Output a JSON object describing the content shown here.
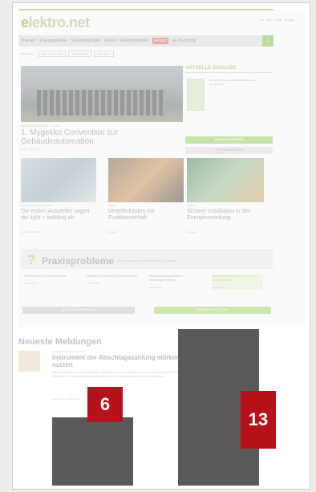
{
  "site": {
    "logo": "elektro.net",
    "logo_letter": "e",
    "top_links": "Abo · Jobs · Kontakt · Newsletter",
    "nav": [
      "Themen",
      "Praxisprobleme",
      "Veranstaltungen",
      "Preise",
      "Elektrohelpdesk"
    ],
    "nav_highlight": "ePaper",
    "nav_shop": "de-Buchshop",
    "search_icon": "search-icon",
    "subnav_label": "Topthemen:",
    "subnav": [
      "light + building 2024",
      "Elektromobilität",
      "Smart Home"
    ]
  },
  "hero": {
    "meta": "GEBÄUDEAUTOMATION · PRAXIS",
    "title": "1. Mygekko Convention zur Gebäudeautomation",
    "date": "News · 30.08.2024"
  },
  "issue": {
    "title": "AKTUELLE AUSGABE",
    "text": "de 6/2024 Jetzt die aktuelle Ausgabe der de kennenlernen",
    "primary_button": "INHALT & BLÄTTERN",
    "secondary_button": "JETZT ABONNIEREN"
  },
  "cards": [
    {
      "tag": "MESSEN & VERANSTALTUNGEN",
      "title": "Die ersten Aussteller sagen die light + building ab",
      "date": "News · 30.08.2024"
    },
    {
      "tag": "ANZEIGE",
      "title": "Verteilerkästen mit Funktionserhalt",
      "date": "Anzeige"
    },
    {
      "tag": "ANZEIGE",
      "title": "Sichere Installation in der Energieverteilung",
      "date": "Anzeige"
    }
  ],
  "praxis": {
    "title": "Praxisprobleme",
    "subtitle": "Ihre Fragen an unsere Branchen-Experten",
    "items": [
      {
        "title": "Prüffristen bei E-Check-Prüfungen",
        "date": "am 01.09.2024"
      },
      {
        "title": "Qualität von Prüfung und Dokumentation",
        "date": "am 29.08.2024"
      },
      {
        "title": "Verdrahtungsquerschnitt in Wohnungsverteilung",
        "date": "am 28.08.2024"
      },
      {
        "title": "Überspannungsschutz für Ein-Kabel-Anschlussdosen",
        "date": "am 28.08.2024"
      }
    ],
    "all_button": "ALLE PRAXISPROBLEME",
    "ask_button": "FACHFRAGE STELLEN"
  },
  "news": {
    "heading": "Neueste Meldungen",
    "tag": "NORMEN & VORSCHRIFTEN",
    "title": "Instrument der Abschlagszahlung stärker nutzen",
    "body": "Bei Bauverträgen, die auf Stundenlohn geschlossen werden, handelt es sich in der Regel um Werkverträge bei denen der Gegenstand gut vorab planbar ist und entsprechend bewertet werden kann.",
    "date": "Empfehlung · 30.08.2024",
    "more": "mehr"
  },
  "badges": {
    "left": "6",
    "right": "13"
  },
  "colors": {
    "brand_green": "#8bc34a",
    "badge_red": "#b5121b",
    "shade": "#595959"
  }
}
